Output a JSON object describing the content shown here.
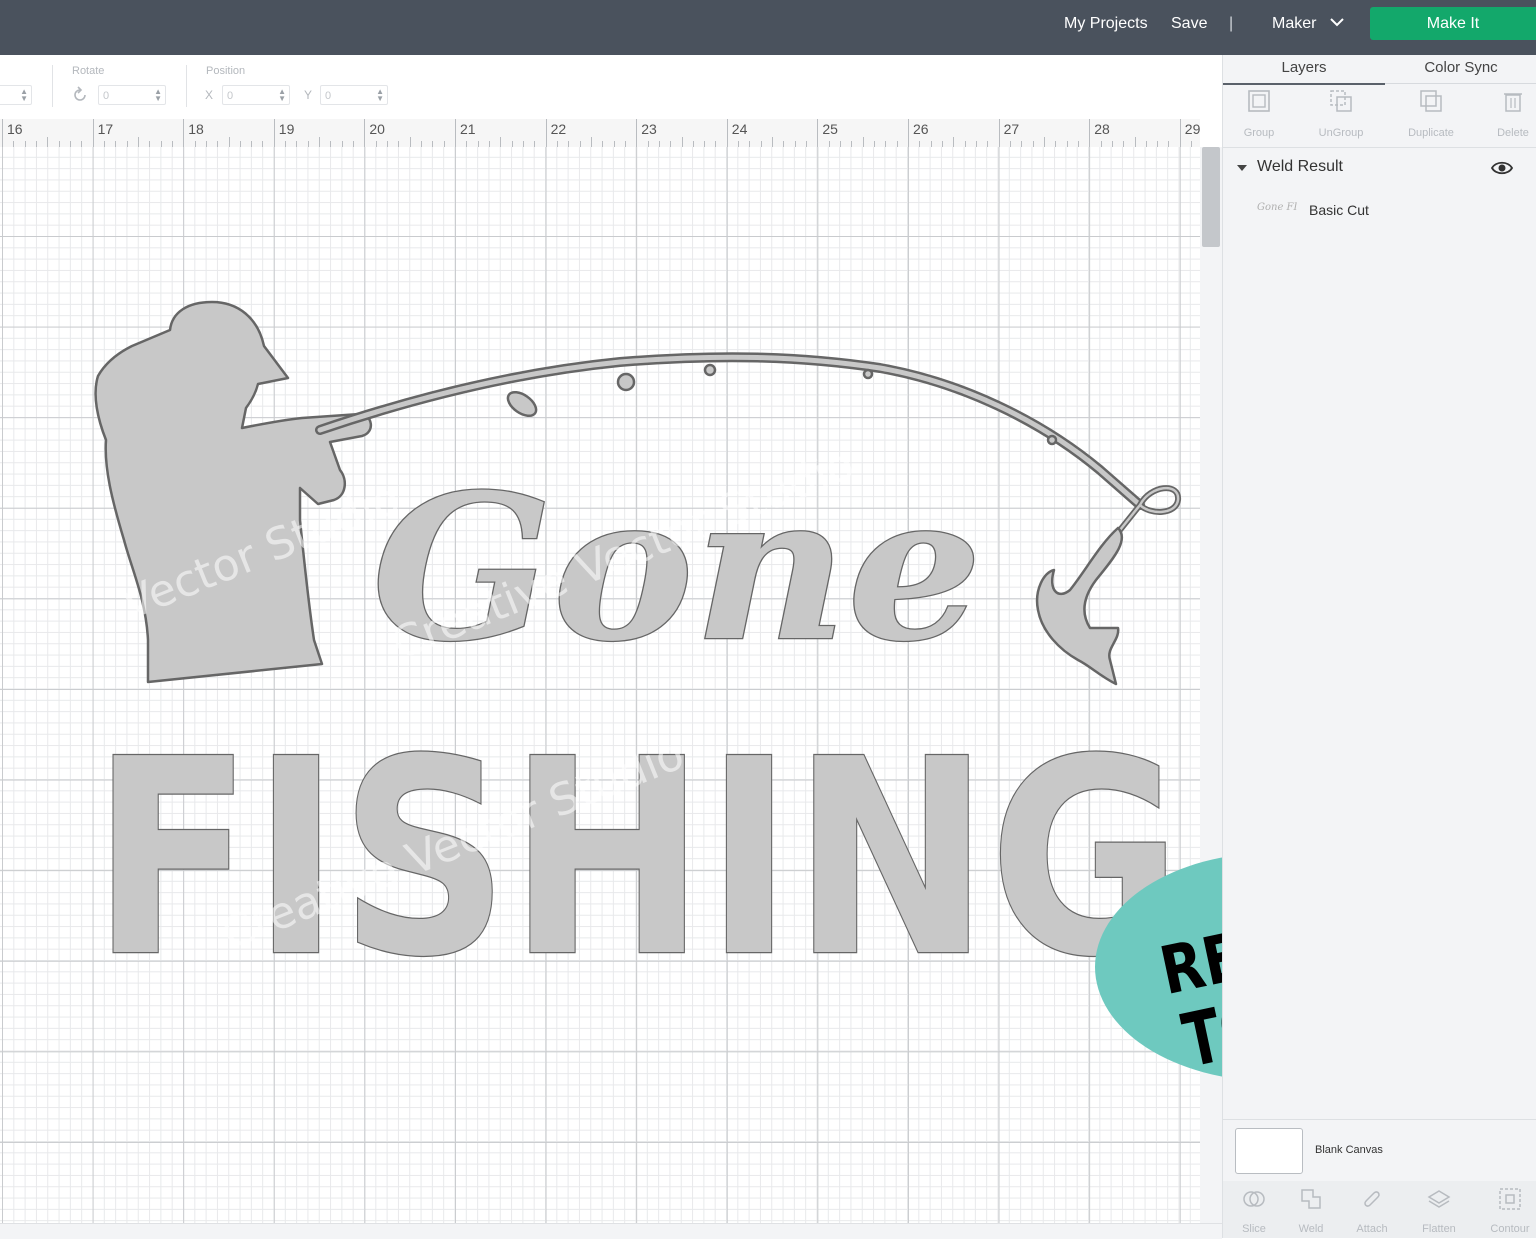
{
  "topbar": {
    "my_projects": "My Projects",
    "save": "Save",
    "separator": "|",
    "machine": "Maker",
    "make_it": "Make It"
  },
  "toolbar": {
    "rotate_label": "Rotate",
    "rotate_value": "0",
    "position_label": "Position",
    "x_label": "X",
    "x_value": "0",
    "y_label": "Y",
    "y_value": "0"
  },
  "ruler": {
    "ticks": [
      "16",
      "17",
      "18",
      "19",
      "20",
      "21",
      "22",
      "23",
      "24",
      "25",
      "26",
      "27",
      "28",
      "29"
    ]
  },
  "design": {
    "script_text": "Gone",
    "block_text": "FISHING",
    "watermarks": [
      "Vector Studio",
      "Creative Vector Studio",
      "Creative Vector Studio"
    ]
  },
  "badge": {
    "line1": "READY",
    "line2": "TO CUT",
    "color": "#6ec9bf"
  },
  "panel": {
    "tabs": [
      "Layers",
      "Color Sync"
    ],
    "actions": [
      "Group",
      "UnGroup",
      "Duplicate",
      "Delete"
    ],
    "group_name": "Weld Result",
    "layer_name": "Basic Cut",
    "layer_thumb_text": "Gone FISHING",
    "canvas_label": "Blank Canvas",
    "bottom_tools": [
      "Slice",
      "Weld",
      "Attach",
      "Flatten",
      "Contour"
    ]
  },
  "colors": {
    "topbar": "#4a525d",
    "make_it": "#13a86b",
    "design_fill": "#c8c8c8"
  }
}
